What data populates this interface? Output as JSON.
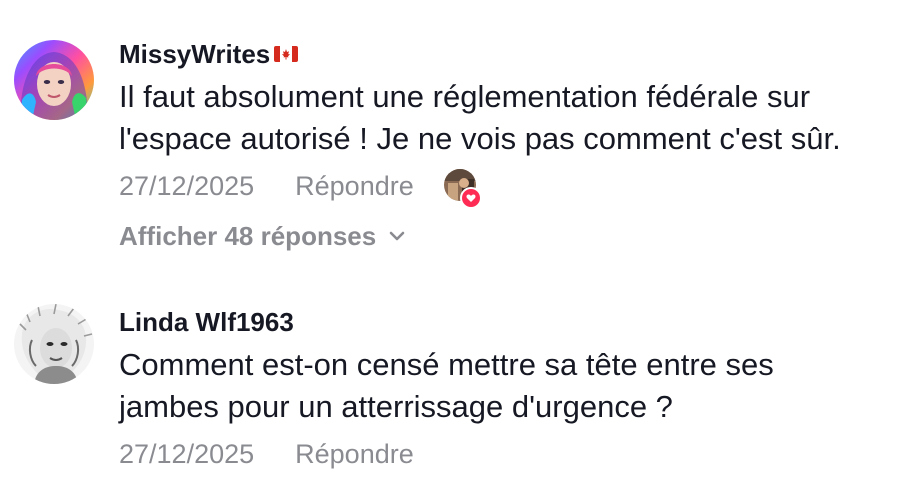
{
  "comments": [
    {
      "username": "MissyWrites",
      "flag_icon": "canada-flag-icon",
      "text_line1": "Il faut absolument une réglementation fédérale sur",
      "text_line2": "l'espace autorisé ! Je ne vois pas comment c'est sûr.",
      "date": "27/12/2025",
      "reply_label": "Répondre",
      "view_replies_label": "Afficher 48 réponses",
      "liked_by_creator": true
    },
    {
      "username": "Linda Wlf1963",
      "text_line1": "Comment est-on censé mettre sa tête entre ses",
      "text_line2": "jambes pour un atterrissage d'urgence ?",
      "date": "27/12/2025",
      "reply_label": "Répondre"
    }
  ],
  "colors": {
    "text_primary": "#161823",
    "text_secondary": "#8a8b91",
    "heart": "#fe2c55",
    "flag_red": "#d52b1e"
  }
}
